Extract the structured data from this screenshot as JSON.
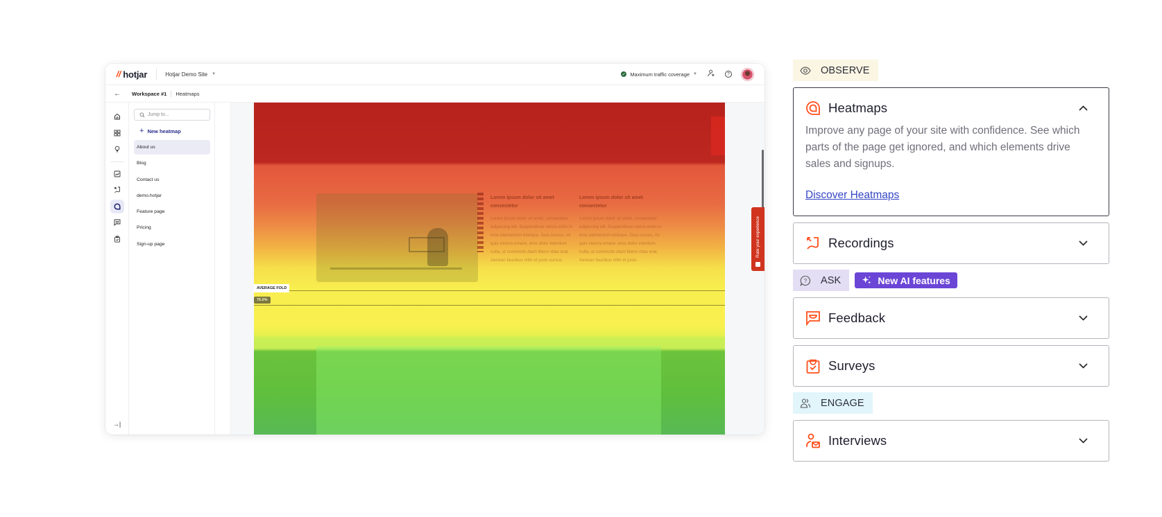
{
  "app": {
    "logo_text": "hotjar",
    "site_selector": "Hotjar Demo Site",
    "traffic_coverage": "Maximum traffic coverage",
    "breadcrumb": {
      "workspace": "Workspace #1",
      "page": "Heatmaps"
    }
  },
  "nav": {
    "search_placeholder": "Jump to...",
    "new_heatmap_label": "New heatmap",
    "items": [
      {
        "label": "About us",
        "active": true
      },
      {
        "label": "Blog"
      },
      {
        "label": "Contact us"
      },
      {
        "label": "demo.hotjar"
      },
      {
        "label": "Feature page"
      },
      {
        "label": "Pricing"
      },
      {
        "label": "Sign-up page"
      }
    ]
  },
  "heatmap": {
    "columns": [
      {
        "heading": "Lorem ipsum dolor sit amet consectetur",
        "body": "Lorem ipsum dolor sit amet, consectetur adipiscing elit. Suspendisse varius enim in eros elementum tristique. Duis cursus, mi quis viverra ornare, eros dolor interdum nulla, ut commodo diam libero vitae erat. Aenean faucibus nibh et justo cursus."
      },
      {
        "heading": "Lorem ipsum dolor sit amet consectetur",
        "body": "Lorem ipsum dolor sit amet, consectetur adipiscing elit. Suspendisse varius enim in eros elementum tristique. Duis cursus, mi quis viverra ornare, eros dolor interdum nulla, ut commodo diam libero vitae erat. Aenean faucibus nibh et justo."
      }
    ],
    "fold_label": "AVERAGE FOLD",
    "fold_percent": "75.0%",
    "feedback_tab": "Rate your experience"
  },
  "panel": {
    "sections": {
      "observe": "OBSERVE",
      "ask": "ASK",
      "engage": "ENGAGE"
    },
    "ai_badge": "New AI features",
    "accent_color": "#ff4e1a",
    "cards": {
      "heatmaps": {
        "title": "Heatmaps",
        "description": "Improve any page of your site with confidence. See which parts of the page get ignored, and which elements drive sales and signups.",
        "link": "Discover Heatmaps",
        "expanded": true
      },
      "recordings": {
        "title": "Recordings",
        "expanded": false
      },
      "feedback": {
        "title": "Feedback",
        "expanded": false
      },
      "surveys": {
        "title": "Surveys",
        "expanded": false
      },
      "interviews": {
        "title": "Interviews",
        "expanded": false
      }
    }
  }
}
